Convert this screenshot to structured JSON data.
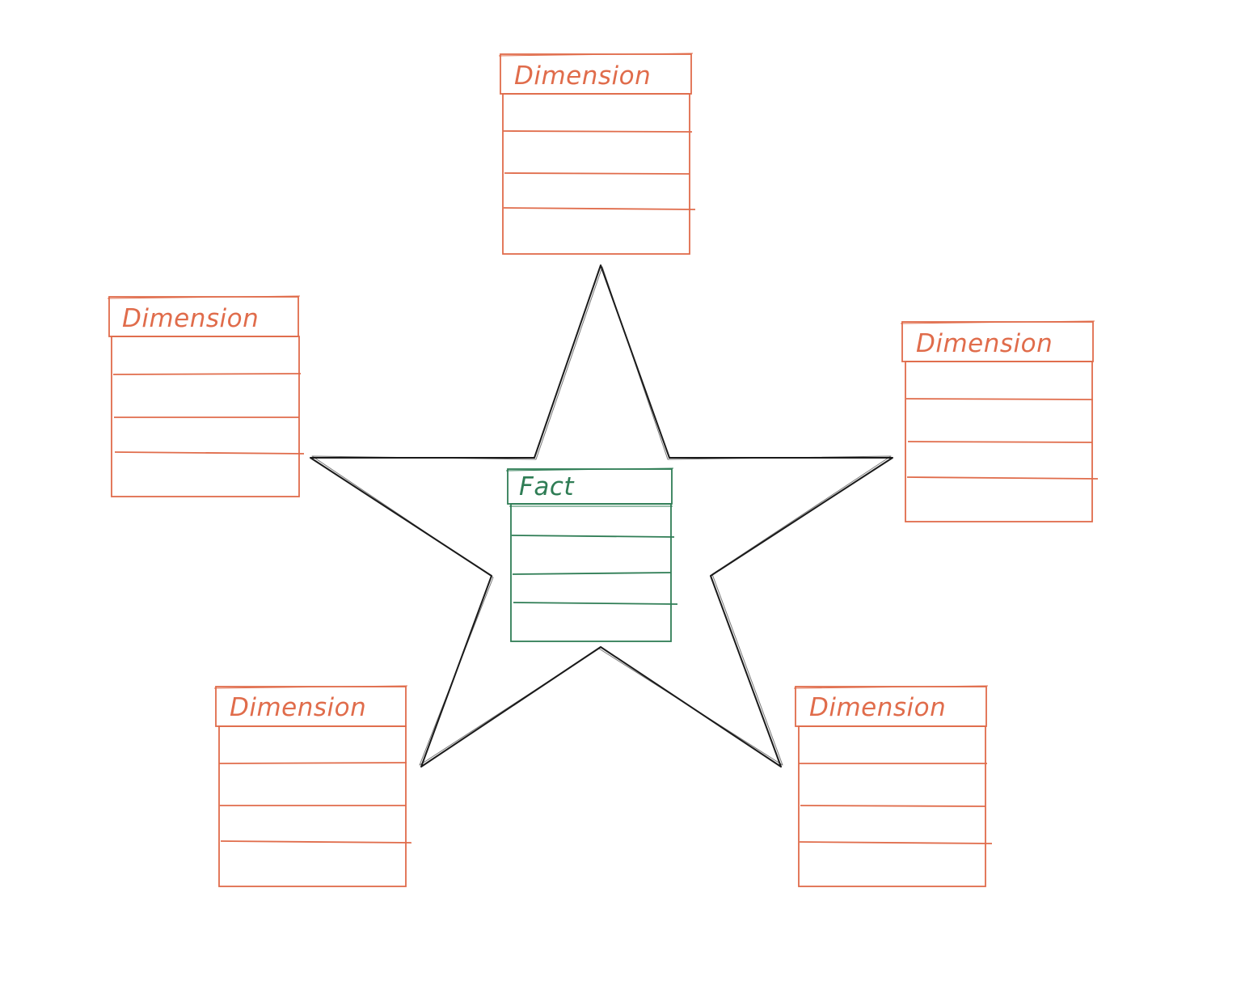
{
  "diagram": {
    "colors": {
      "dimension": "#e06c4b",
      "fact": "#2f7d55",
      "star": "#1a1a1a",
      "background": "#ffffff"
    },
    "fact_table": {
      "title": "Fact",
      "row_count": 4
    },
    "dimension_tables": [
      {
        "title": "Dimension",
        "row_count": 4
      },
      {
        "title": "Dimension",
        "row_count": 4
      },
      {
        "title": "Dimension",
        "row_count": 4
      },
      {
        "title": "Dimension",
        "row_count": 4
      },
      {
        "title": "Dimension",
        "row_count": 4
      }
    ]
  }
}
